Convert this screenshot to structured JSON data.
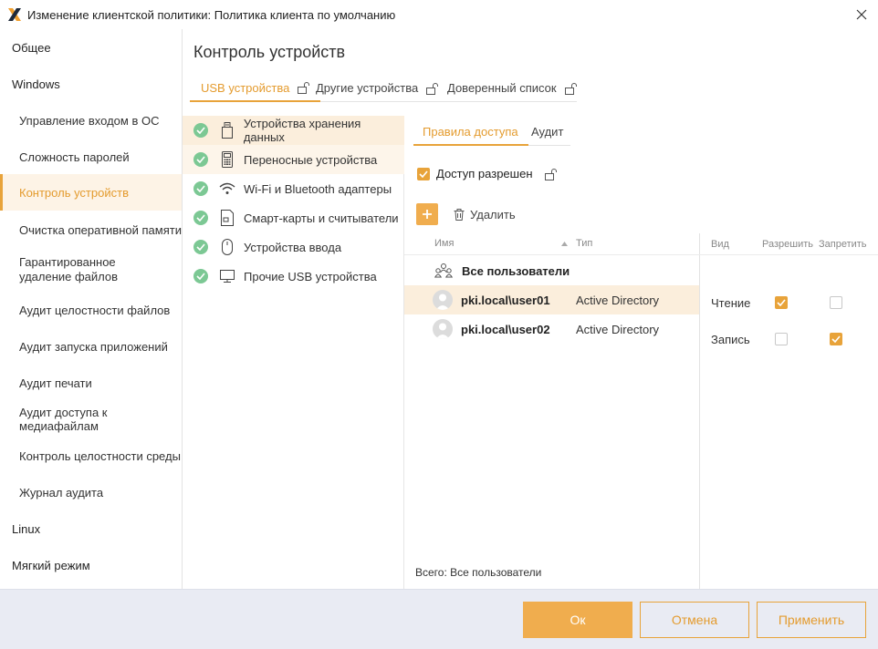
{
  "window": {
    "title": "Изменение клиентской политики: Политика клиента по умолчанию",
    "accent": "#E8A33A"
  },
  "sidebar": {
    "items": [
      {
        "label": "Общее",
        "level": "top",
        "active": false
      },
      {
        "label": "Windows",
        "level": "top",
        "active": false
      },
      {
        "label": "Управление входом в ОС",
        "level": "sub",
        "active": false
      },
      {
        "label": "Сложность паролей",
        "level": "sub",
        "active": false
      },
      {
        "label": "Контроль устройств",
        "level": "sub",
        "active": true
      },
      {
        "label": "Очистка оперативной памяти",
        "level": "sub",
        "active": false
      },
      {
        "label_line1": "Гарантированное",
        "label_line2": "удаление файлов",
        "level": "sub",
        "active": false
      },
      {
        "label": "Аудит целостности файлов",
        "level": "sub",
        "active": false
      },
      {
        "label": "Аудит запуска приложений",
        "level": "sub",
        "active": false
      },
      {
        "label": "Аудит печати",
        "level": "sub",
        "active": false
      },
      {
        "label": "Аудит доступа к медиафайлам",
        "level": "sub",
        "active": false
      },
      {
        "label": "Контроль целостности среды",
        "level": "sub",
        "active": false
      },
      {
        "label": "Журнал аудита",
        "level": "sub",
        "active": false
      },
      {
        "label": "Linux",
        "level": "top",
        "active": false
      },
      {
        "label": "Мягкий режим",
        "level": "top",
        "active": false
      }
    ]
  },
  "main": {
    "title": "Контроль устройств",
    "tabs": [
      {
        "label": "USB устройства",
        "active": true,
        "icon": "unlock-icon"
      },
      {
        "label": "Другие устройства",
        "active": false,
        "icon": "unlock-icon"
      },
      {
        "label": "Доверенный список",
        "active": false,
        "icon": "unlock-icon"
      }
    ],
    "devices": [
      {
        "label": "Устройства хранения данных",
        "icon": "usb-drive-icon",
        "selected": true
      },
      {
        "label": "Переносные устройства",
        "icon": "portable-device-icon",
        "selected": false
      },
      {
        "label": "Wi-Fi и Bluetooth адаптеры",
        "icon": "wifi-icon",
        "selected": false
      },
      {
        "label": "Смарт-карты и считыватели",
        "icon": "smartcard-icon",
        "selected": false
      },
      {
        "label": "Устройства ввода",
        "icon": "mouse-icon",
        "selected": false
      },
      {
        "label": "Прочие USB устройства",
        "icon": "monitor-icon",
        "selected": false
      }
    ],
    "subtabs": [
      {
        "label": "Правила доступа",
        "active": true
      },
      {
        "label": "Аудит",
        "active": false
      }
    ],
    "access_allowed": {
      "label": "Доступ разрешен",
      "checked": true
    },
    "delete_label": "Удалить",
    "table": {
      "col_name": "Имя",
      "col_type": "Тип",
      "rows": [
        {
          "name": "Все пользователи",
          "type": "",
          "icon": "users-group-icon",
          "selected": false
        },
        {
          "name": "pki.local\\user01",
          "type": "Active Directory",
          "icon": "user-avatar-icon",
          "selected": true
        },
        {
          "name": "pki.local\\user02",
          "type": "Active Directory",
          "icon": "user-avatar-icon",
          "selected": false
        }
      ],
      "footer_label": "Всего:",
      "footer_value": "Все пользователи"
    },
    "permissions": {
      "col_kind": "Вид",
      "col_allow": "Разрешить",
      "col_deny": "Запретить",
      "rows": [
        {
          "label": "Чтение",
          "allow": true,
          "deny": false
        },
        {
          "label": "Запись",
          "allow": false,
          "deny": true
        }
      ]
    }
  },
  "buttons": {
    "ok": "Ок",
    "cancel": "Отмена",
    "apply": "Применить"
  }
}
